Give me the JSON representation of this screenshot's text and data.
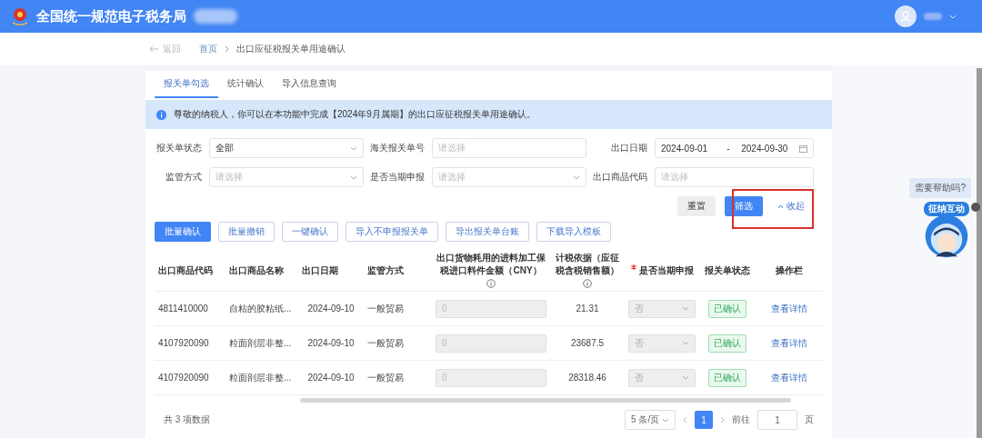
{
  "header": {
    "title": "全国统一规范电子税务局"
  },
  "breadcrumb": {
    "back": "返回",
    "items": [
      "首页",
      "出口应征税报关单用途确认"
    ]
  },
  "tabs": [
    {
      "label": "报关单勾选",
      "selected": true
    },
    {
      "label": "统计确认",
      "selected": false
    },
    {
      "label": "导入信息查询",
      "selected": false
    }
  ],
  "notice": "尊敬的纳税人，你可以在本功能中完成【2024年9月属期】的出口应征税报关单用途确认。",
  "filters": [
    {
      "kind": "select",
      "label": "报关单状态",
      "value": "全部"
    },
    {
      "kind": "input",
      "label": "海关报关单号",
      "placeholder": "请选择"
    },
    {
      "kind": "daterange",
      "label": "出口日期",
      "start": "2024-09-01",
      "separator": "-",
      "end": "2024-09-30"
    },
    {
      "kind": "select",
      "label": "监管方式",
      "placeholder": "请选择"
    },
    {
      "kind": "select",
      "label": "是否当期申报",
      "placeholder": "请选择"
    },
    {
      "kind": "input",
      "label": "出口商品代码",
      "placeholder": "请选择"
    }
  ],
  "filter_buttons": {
    "reset": "重置",
    "filter": "筛选",
    "collapse": "收起",
    "highlighted": true
  },
  "actions": [
    {
      "label": "批量确认",
      "primary": true
    },
    {
      "label": "批量撤销",
      "primary": false
    },
    {
      "label": "一键确认",
      "primary": false
    },
    {
      "label": "导入不申报报关单",
      "primary": false
    },
    {
      "label": "导出报关单台账",
      "primary": false
    },
    {
      "label": "下载导入模板",
      "primary": false
    }
  ],
  "table": {
    "columns": [
      {
        "label": "出口商品代码"
      },
      {
        "label": "出口商品名称"
      },
      {
        "label": "出口日期"
      },
      {
        "label": "监管方式"
      },
      {
        "label": "出口货物耗用的进料加工保税进口料件金额（CNY）",
        "info": true
      },
      {
        "label": "计税依据（应征税含税销售额）",
        "info": true
      },
      {
        "label": "是否当期申报",
        "required": true
      },
      {
        "label": "报关单状态"
      },
      {
        "label": "操作栏"
      }
    ],
    "rows": [
      {
        "code": "4811410000",
        "name": "自粘的胶粘纸...",
        "date": "2024-09-10",
        "method": "一般贸易",
        "amount": "0",
        "basis": "21.31",
        "current": "否",
        "status": "已确认",
        "action": "查看详情"
      },
      {
        "code": "4107920090",
        "name": "粒面剖层非整...",
        "date": "2024-09-10",
        "method": "一般贸易",
        "amount": "0",
        "basis": "23687.5",
        "current": "否",
        "status": "已确认",
        "action": "查看详情"
      },
      {
        "code": "4107920090",
        "name": "粒面剖层非整...",
        "date": "2024-09-10",
        "method": "一般贸易",
        "amount": "0",
        "basis": "28318.46",
        "current": "否",
        "status": "已确认",
        "action": "查看详情"
      }
    ]
  },
  "pagination": {
    "total": "共 3 项数据",
    "page_size": "5 条/页",
    "pages": [
      {
        "label": "1",
        "selected": true
      }
    ],
    "goto": "前往",
    "goto_value": "1",
    "goto_suffix": "页"
  },
  "helper": {
    "bubble": "需要帮助吗?",
    "badge": "征纳互动"
  }
}
